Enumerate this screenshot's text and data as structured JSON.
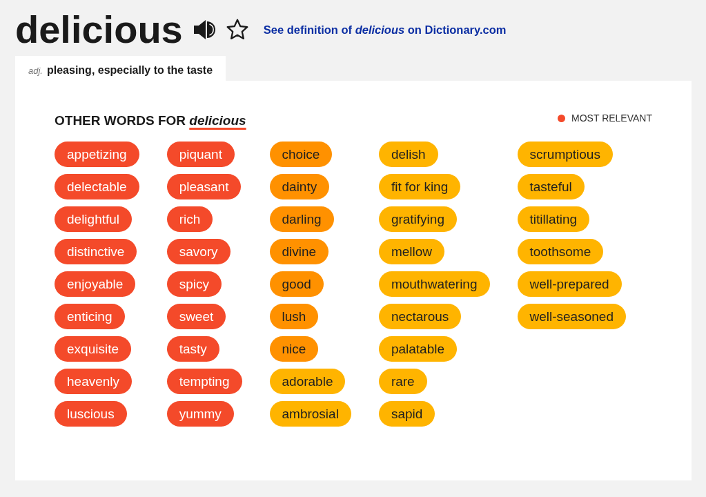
{
  "entry": {
    "word": "delicious",
    "definition_link": "See definition of *delicious* on Dictionary.com"
  },
  "definition_tab": {
    "part_of_speech": "adj.",
    "definition": "pleasing, especially to the taste"
  },
  "synonyms": {
    "heading": "OTHER WORDS FOR *delicious*",
    "legend": {
      "label": "MOST RELEVANT",
      "color": "#f44a2a"
    },
    "columns": [
      [
        {
          "word": "appetizing",
          "color": "#f44a2a"
        },
        {
          "word": "delectable",
          "color": "#f44a2a"
        },
        {
          "word": "delightful",
          "color": "#f44a2a"
        },
        {
          "word": "distinctive",
          "color": "#f44a2a"
        },
        {
          "word": "enjoyable",
          "color": "#f44a2a"
        },
        {
          "word": "enticing",
          "color": "#f44a2a"
        },
        {
          "word": "exquisite",
          "color": "#f44a2a"
        },
        {
          "word": "heavenly",
          "color": "#f44a2a"
        },
        {
          "word": "luscious",
          "color": "#f44a2a"
        }
      ],
      [
        {
          "word": "piquant",
          "color": "#f44a2a"
        },
        {
          "word": "pleasant",
          "color": "#f44a2a"
        },
        {
          "word": "rich",
          "color": "#f44a2a"
        },
        {
          "word": "savory",
          "color": "#f44a2a"
        },
        {
          "word": "spicy",
          "color": "#f44a2a"
        },
        {
          "word": "sweet",
          "color": "#f44a2a"
        },
        {
          "word": "tasty",
          "color": "#f44a2a"
        },
        {
          "word": "tempting",
          "color": "#f44a2a"
        },
        {
          "word": "yummy",
          "color": "#f44a2a"
        }
      ],
      [
        {
          "word": "choice",
          "color": "#ff9100"
        },
        {
          "word": "dainty",
          "color": "#ff9100"
        },
        {
          "word": "darling",
          "color": "#ff9100"
        },
        {
          "word": "divine",
          "color": "#ff9100"
        },
        {
          "word": "good",
          "color": "#ff9100"
        },
        {
          "word": "lush",
          "color": "#ff9100"
        },
        {
          "word": "nice",
          "color": "#ff9100"
        },
        {
          "word": "adorable",
          "color": "#ffb400"
        },
        {
          "word": "ambrosial",
          "color": "#ffb400"
        }
      ],
      [
        {
          "word": "delish",
          "color": "#ffb400"
        },
        {
          "word": "fit for king",
          "color": "#ffb400"
        },
        {
          "word": "gratifying",
          "color": "#ffb400"
        },
        {
          "word": "mellow",
          "color": "#ffb400"
        },
        {
          "word": "mouthwatering",
          "color": "#ffb400"
        },
        {
          "word": "nectarous",
          "color": "#ffb400"
        },
        {
          "word": "palatable",
          "color": "#ffb400"
        },
        {
          "word": "rare",
          "color": "#ffb400"
        },
        {
          "word": "sapid",
          "color": "#ffb400"
        }
      ],
      [
        {
          "word": "scrumptious",
          "color": "#ffb400"
        },
        {
          "word": "tasteful",
          "color": "#ffb400"
        },
        {
          "word": "titillating",
          "color": "#ffb400"
        },
        {
          "word": "toothsome",
          "color": "#ffb400"
        },
        {
          "word": "well-prepared",
          "color": "#ffb400"
        },
        {
          "word": "well-seasoned",
          "color": "#ffb400"
        }
      ]
    ]
  }
}
